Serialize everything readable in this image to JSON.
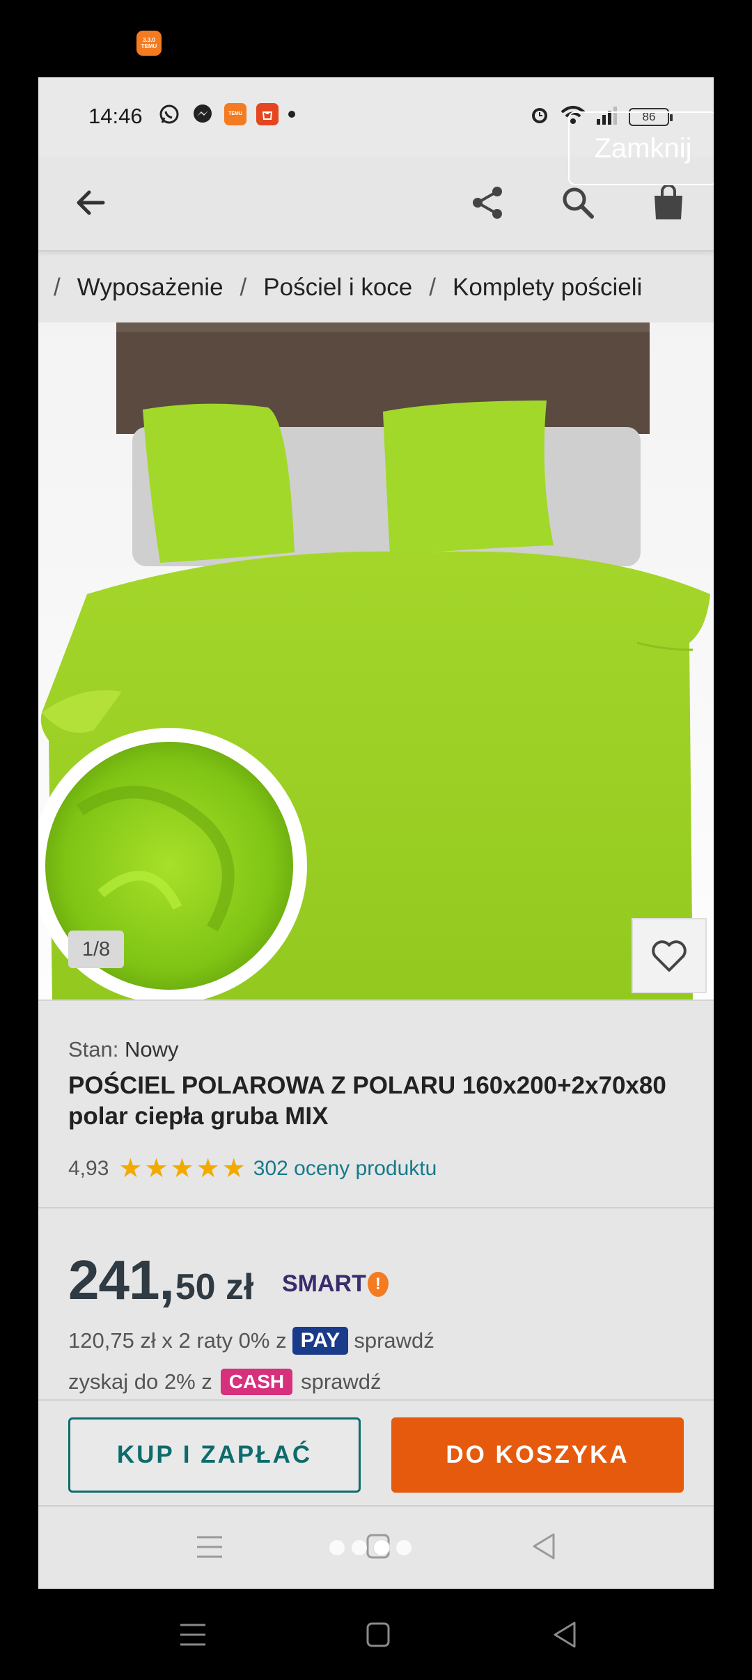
{
  "outer": {
    "app_icon_label": "3.3.0 TEMU"
  },
  "status": {
    "time": "14:46",
    "battery": "86",
    "temu_badge": "TEMU"
  },
  "overlay": {
    "close_label": "Zamknij"
  },
  "breadcrumb": {
    "separator": "/",
    "items": [
      "Wyposażenie",
      "Pościel i koce",
      "Komplety pościeli"
    ]
  },
  "gallery": {
    "counter": "1/8"
  },
  "product": {
    "condition_key": "Stan:",
    "condition_value": "Nowy",
    "title": "POŚCIEL POLAROWA Z POLARU 160x200+2x70x80 polar ciepła gruba MIX",
    "rating": "4,93",
    "stars": 5,
    "reviews": "302 oceny produktu"
  },
  "price": {
    "integer": "241,",
    "decimal": "50 zł",
    "smart": "SMART",
    "smart_badge": "!",
    "installment_text": "120,75 zł x 2 raty 0% z",
    "pay_badge": "PAY",
    "installment_check": "sprawdź",
    "cash_text": "zyskaj do 2% z",
    "cash_badge": "CASH",
    "cash_check": "sprawdź"
  },
  "actions": {
    "buy": "KUP I ZAPŁAĆ",
    "cart": "DO KOSZYKA"
  },
  "colors": {
    "accent_orange": "#e55a0c",
    "teal": "#0e6b6b",
    "star": "#f2a900",
    "pay_blue": "#1a3a8a",
    "cash_pink": "#d7307d"
  }
}
